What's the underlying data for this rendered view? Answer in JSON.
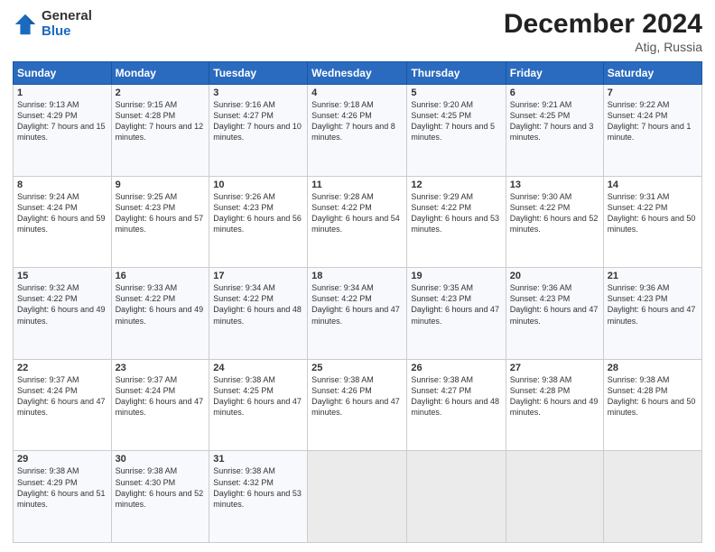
{
  "header": {
    "logo_general": "General",
    "logo_blue": "Blue",
    "title": "December 2024",
    "subtitle": "Atig, Russia"
  },
  "weekdays": [
    "Sunday",
    "Monday",
    "Tuesday",
    "Wednesday",
    "Thursday",
    "Friday",
    "Saturday"
  ],
  "weeks": [
    [
      {
        "day": "1",
        "sunrise": "Sunrise: 9:13 AM",
        "sunset": "Sunset: 4:29 PM",
        "daylight": "Daylight: 7 hours and 15 minutes."
      },
      {
        "day": "2",
        "sunrise": "Sunrise: 9:15 AM",
        "sunset": "Sunset: 4:28 PM",
        "daylight": "Daylight: 7 hours and 12 minutes."
      },
      {
        "day": "3",
        "sunrise": "Sunrise: 9:16 AM",
        "sunset": "Sunset: 4:27 PM",
        "daylight": "Daylight: 7 hours and 10 minutes."
      },
      {
        "day": "4",
        "sunrise": "Sunrise: 9:18 AM",
        "sunset": "Sunset: 4:26 PM",
        "daylight": "Daylight: 7 hours and 8 minutes."
      },
      {
        "day": "5",
        "sunrise": "Sunrise: 9:20 AM",
        "sunset": "Sunset: 4:25 PM",
        "daylight": "Daylight: 7 hours and 5 minutes."
      },
      {
        "day": "6",
        "sunrise": "Sunrise: 9:21 AM",
        "sunset": "Sunset: 4:25 PM",
        "daylight": "Daylight: 7 hours and 3 minutes."
      },
      {
        "day": "7",
        "sunrise": "Sunrise: 9:22 AM",
        "sunset": "Sunset: 4:24 PM",
        "daylight": "Daylight: 7 hours and 1 minute."
      }
    ],
    [
      {
        "day": "8",
        "sunrise": "Sunrise: 9:24 AM",
        "sunset": "Sunset: 4:24 PM",
        "daylight": "Daylight: 6 hours and 59 minutes."
      },
      {
        "day": "9",
        "sunrise": "Sunrise: 9:25 AM",
        "sunset": "Sunset: 4:23 PM",
        "daylight": "Daylight: 6 hours and 57 minutes."
      },
      {
        "day": "10",
        "sunrise": "Sunrise: 9:26 AM",
        "sunset": "Sunset: 4:23 PM",
        "daylight": "Daylight: 6 hours and 56 minutes."
      },
      {
        "day": "11",
        "sunrise": "Sunrise: 9:28 AM",
        "sunset": "Sunset: 4:22 PM",
        "daylight": "Daylight: 6 hours and 54 minutes."
      },
      {
        "day": "12",
        "sunrise": "Sunrise: 9:29 AM",
        "sunset": "Sunset: 4:22 PM",
        "daylight": "Daylight: 6 hours and 53 minutes."
      },
      {
        "day": "13",
        "sunrise": "Sunrise: 9:30 AM",
        "sunset": "Sunset: 4:22 PM",
        "daylight": "Daylight: 6 hours and 52 minutes."
      },
      {
        "day": "14",
        "sunrise": "Sunrise: 9:31 AM",
        "sunset": "Sunset: 4:22 PM",
        "daylight": "Daylight: 6 hours and 50 minutes."
      }
    ],
    [
      {
        "day": "15",
        "sunrise": "Sunrise: 9:32 AM",
        "sunset": "Sunset: 4:22 PM",
        "daylight": "Daylight: 6 hours and 49 minutes."
      },
      {
        "day": "16",
        "sunrise": "Sunrise: 9:33 AM",
        "sunset": "Sunset: 4:22 PM",
        "daylight": "Daylight: 6 hours and 49 minutes."
      },
      {
        "day": "17",
        "sunrise": "Sunrise: 9:34 AM",
        "sunset": "Sunset: 4:22 PM",
        "daylight": "Daylight: 6 hours and 48 minutes."
      },
      {
        "day": "18",
        "sunrise": "Sunrise: 9:34 AM",
        "sunset": "Sunset: 4:22 PM",
        "daylight": "Daylight: 6 hours and 47 minutes."
      },
      {
        "day": "19",
        "sunrise": "Sunrise: 9:35 AM",
        "sunset": "Sunset: 4:23 PM",
        "daylight": "Daylight: 6 hours and 47 minutes."
      },
      {
        "day": "20",
        "sunrise": "Sunrise: 9:36 AM",
        "sunset": "Sunset: 4:23 PM",
        "daylight": "Daylight: 6 hours and 47 minutes."
      },
      {
        "day": "21",
        "sunrise": "Sunrise: 9:36 AM",
        "sunset": "Sunset: 4:23 PM",
        "daylight": "Daylight: 6 hours and 47 minutes."
      }
    ],
    [
      {
        "day": "22",
        "sunrise": "Sunrise: 9:37 AM",
        "sunset": "Sunset: 4:24 PM",
        "daylight": "Daylight: 6 hours and 47 minutes."
      },
      {
        "day": "23",
        "sunrise": "Sunrise: 9:37 AM",
        "sunset": "Sunset: 4:24 PM",
        "daylight": "Daylight: 6 hours and 47 minutes."
      },
      {
        "day": "24",
        "sunrise": "Sunrise: 9:38 AM",
        "sunset": "Sunset: 4:25 PM",
        "daylight": "Daylight: 6 hours and 47 minutes."
      },
      {
        "day": "25",
        "sunrise": "Sunrise: 9:38 AM",
        "sunset": "Sunset: 4:26 PM",
        "daylight": "Daylight: 6 hours and 47 minutes."
      },
      {
        "day": "26",
        "sunrise": "Sunrise: 9:38 AM",
        "sunset": "Sunset: 4:27 PM",
        "daylight": "Daylight: 6 hours and 48 minutes."
      },
      {
        "day": "27",
        "sunrise": "Sunrise: 9:38 AM",
        "sunset": "Sunset: 4:28 PM",
        "daylight": "Daylight: 6 hours and 49 minutes."
      },
      {
        "day": "28",
        "sunrise": "Sunrise: 9:38 AM",
        "sunset": "Sunset: 4:28 PM",
        "daylight": "Daylight: 6 hours and 50 minutes."
      }
    ],
    [
      {
        "day": "29",
        "sunrise": "Sunrise: 9:38 AM",
        "sunset": "Sunset: 4:29 PM",
        "daylight": "Daylight: 6 hours and 51 minutes."
      },
      {
        "day": "30",
        "sunrise": "Sunrise: 9:38 AM",
        "sunset": "Sunset: 4:30 PM",
        "daylight": "Daylight: 6 hours and 52 minutes."
      },
      {
        "day": "31",
        "sunrise": "Sunrise: 9:38 AM",
        "sunset": "Sunset: 4:32 PM",
        "daylight": "Daylight: 6 hours and 53 minutes."
      },
      null,
      null,
      null,
      null
    ]
  ]
}
